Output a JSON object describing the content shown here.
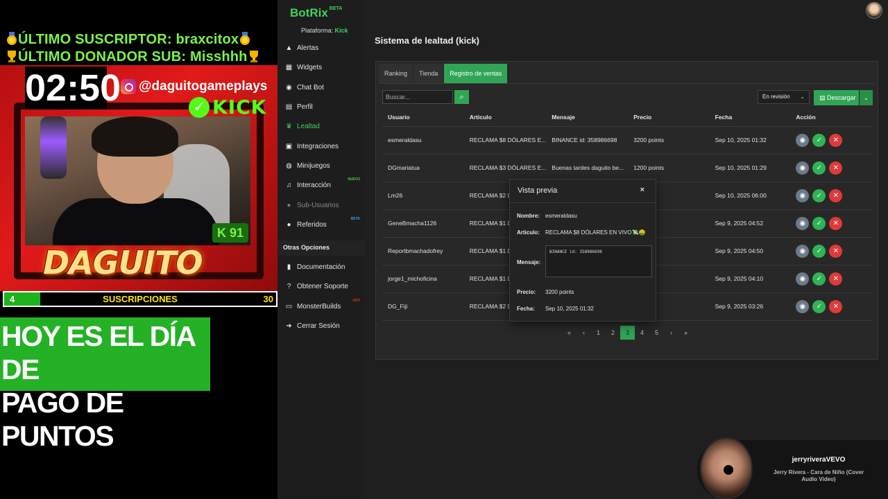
{
  "overlay": {
    "last_subscriber": "ÚLTIMO SUSCRIPTOR: braxcitox",
    "last_donor": "ÚLTIMO DONADOR SUB: Misshhh",
    "timer": "02:50",
    "instagram_handle": "@daguitogameplays",
    "kick_label": "KICK",
    "kick_level": "K 91",
    "streamer_logo": "DAGUITO",
    "subs_current": "4",
    "subs_label": "SUSCRIPCIONES",
    "subs_goal": "30",
    "subs_progress_fraction": 0.133,
    "promo_text_line1": "HOY ES EL DÍA DE",
    "promo_text_line2": "PAGO DE PUNTOS"
  },
  "sidebar": {
    "brand": "BotRix",
    "brand_tag": "BETA",
    "platform_label": "Plataforma:",
    "platform_value": "Kick",
    "items": [
      {
        "label": "Alertas",
        "icon": "warning-icon"
      },
      {
        "label": "Widgets",
        "icon": "grid-icon"
      },
      {
        "label": "Chat Bot",
        "icon": "bot-icon"
      },
      {
        "label": "Perfil",
        "icon": "id-card-icon"
      },
      {
        "label": "Lealtad",
        "icon": "trophy-icon",
        "active": true
      },
      {
        "label": "Integraciones",
        "icon": "plug-icon"
      },
      {
        "label": "Minijuegos",
        "icon": "gamepad-icon"
      },
      {
        "label": "Interacción",
        "icon": "music-icon",
        "tag": "NUEVO"
      },
      {
        "label": "Sub-Usuarios",
        "icon": "users-icon",
        "disabled": true
      },
      {
        "label": "Referidos",
        "icon": "group-icon",
        "tag": "BETA"
      }
    ],
    "other_options_label": "Otras Opciones",
    "other_items": [
      {
        "label": "Documentación",
        "icon": "book-icon"
      },
      {
        "label": "Obtener Soporte",
        "icon": "help-icon"
      },
      {
        "label": "MonsterBuilds",
        "icon": "monitor-icon",
        "tag": "HOT"
      },
      {
        "label": "Cerrar Sesión",
        "icon": "logout-icon"
      }
    ]
  },
  "main": {
    "title": "Sistema de lealtad (kick)",
    "tabs": [
      "Ranking",
      "Tienda",
      "Registro de ventas"
    ],
    "active_tab": 2,
    "search_placeholder": "Buscar...",
    "status_filter": "En revisión",
    "download_label": "Descargar",
    "columns": [
      "Usuario",
      "Articulo",
      "Mensaje",
      "Precio",
      "Fecha",
      "Acción"
    ],
    "rows": [
      {
        "user": "esmeraldasu",
        "item": "RECLAMA $8 DÓLARES E...",
        "message": "BINANCE id: 358986698",
        "price": "3200 points",
        "date": "Sep 10, 2025 01:32"
      },
      {
        "user": "DGmariatua",
        "item": "RECLAMA $3 DÓLARES E...",
        "message": "Buenas tardes daguito be...",
        "price": "1200 points",
        "date": "Sep 10, 2025 01:29"
      },
      {
        "user": "Lm26",
        "item": "RECLAMA $2 D",
        "message": "",
        "price": "s",
        "date": "Sep 10, 2025 06:00"
      },
      {
        "user": "GeneBmacha1126",
        "item": "RECLAMA $1 D",
        "message": "",
        "price": "s",
        "date": "Sep 9, 2025 04:52"
      },
      {
        "user": "Reportbmachadofrey",
        "item": "RECLAMA $1 D",
        "message": "",
        "price": "s",
        "date": "Sep 9, 2025 04:50"
      },
      {
        "user": "jorge1_michoficina",
        "item": "RECLAMA $1 D",
        "message": "",
        "price": "s",
        "date": "Sep 9, 2025 04:10"
      },
      {
        "user": "DG_Fiji",
        "item": "RECLAMA $2 D",
        "message": "",
        "price": "s",
        "date": "Sep 9, 2025 03:26"
      }
    ],
    "pagination": [
      "«",
      "‹",
      "1",
      "2",
      "3",
      "4",
      "5",
      "›",
      "»"
    ],
    "active_page": "3"
  },
  "modal": {
    "title": "Vista previa",
    "close": "×",
    "name_label": "Nombre:",
    "name_value": "esmeraldasu",
    "item_label": "Articulo:",
    "item_value": "RECLAMA $8 DÓLARES EN VIVO💸🤑",
    "message_label": "Mensaje:",
    "message_value": "BINANCE id: 358986698",
    "price_label": "Precio:",
    "price_value": "3200 points",
    "date_label": "Fecha:",
    "date_value": "Sep 10, 2025 01:32"
  },
  "now_playing": {
    "artist": "jerryriveraVEVO",
    "title": "Jerry Rivera - Cara de Niño (Cover Audio Video)"
  },
  "colors": {
    "accent_green": "#30a556",
    "brand_green": "#41d15c",
    "danger_red": "#e03a3a",
    "overlay_red": "#e21a1a"
  }
}
